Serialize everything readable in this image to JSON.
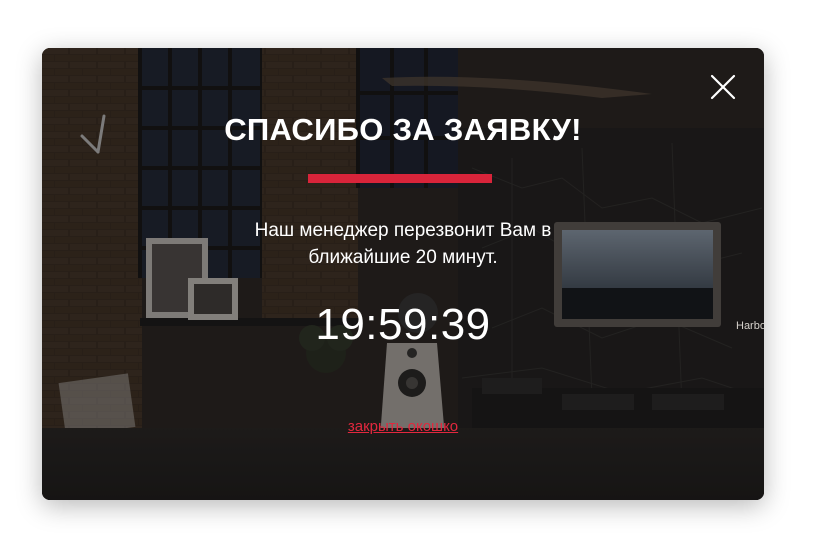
{
  "modal": {
    "title": "СПАСИБО ЗА ЗАЯВКУ!",
    "message_line1": "Наш менеджер перезвонит Вам в",
    "message_line2": "ближайшие 20 минут.",
    "timer": "19:59:39",
    "close_link_label": "закрыть окошко",
    "close_icon": "close-x-icon",
    "accent_color": "#d8243a"
  },
  "background": {
    "sign_text": "Harbo"
  }
}
